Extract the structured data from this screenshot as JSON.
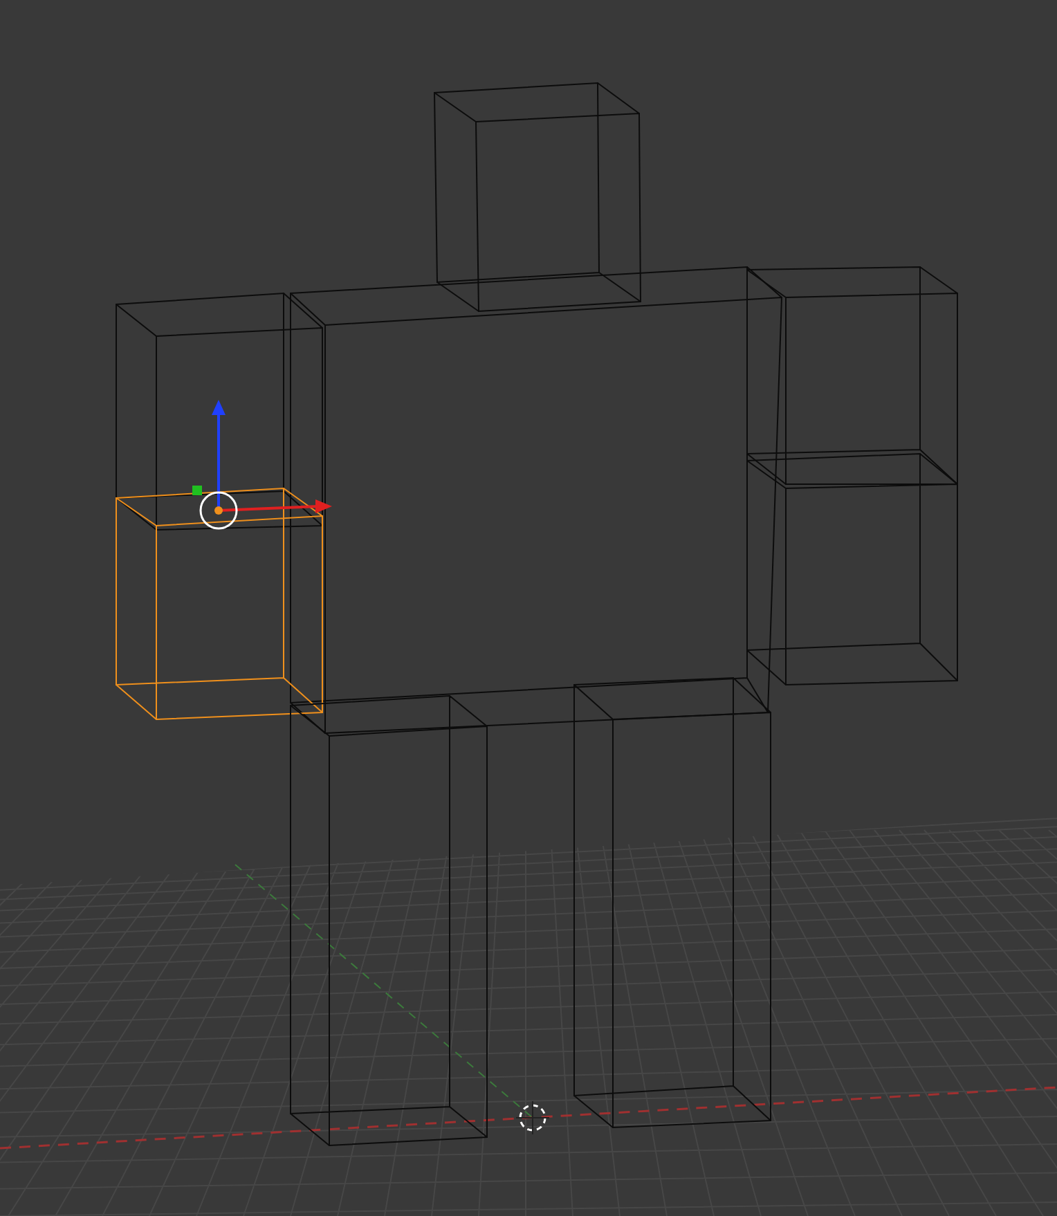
{
  "viewport": {
    "objects": [
      {
        "kind": "head",
        "selected": false
      },
      {
        "kind": "torso",
        "selected": false
      },
      {
        "kind": "left-upper-arm",
        "selected": false
      },
      {
        "kind": "left-lower-arm",
        "selected": true
      },
      {
        "kind": "right-upper-arm",
        "selected": false
      },
      {
        "kind": "right-lower-arm",
        "selected": false
      },
      {
        "kind": "left-leg",
        "selected": false
      },
      {
        "kind": "right-leg",
        "selected": false
      }
    ]
  }
}
